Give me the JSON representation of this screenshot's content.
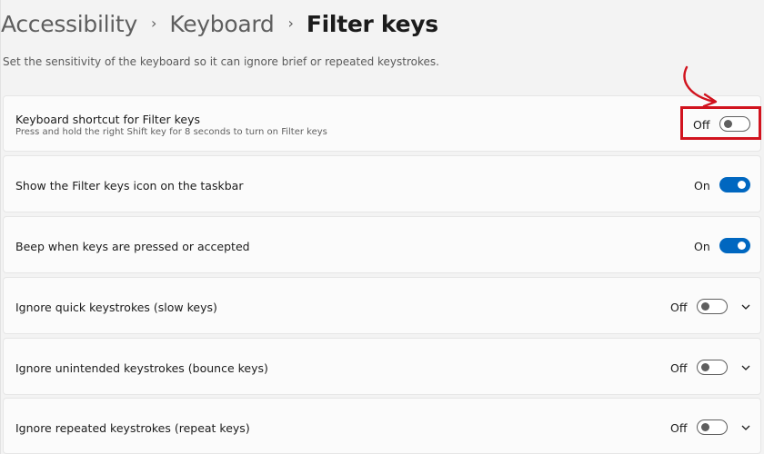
{
  "breadcrumb": {
    "items": [
      "Accessibility",
      "Keyboard",
      "Filter keys"
    ]
  },
  "description": "Set the sensitivity of the keyboard so it can ignore brief or repeated keystrokes.",
  "settings": [
    {
      "title": "Keyboard shortcut for Filter keys",
      "subtitle": "Press and hold the right Shift key for 8 seconds to turn on Filter keys",
      "state": "Off",
      "on": false,
      "expandable": false
    },
    {
      "title": "Show the Filter keys icon on the taskbar",
      "state": "On",
      "on": true,
      "expandable": false
    },
    {
      "title": "Beep when keys are pressed or accepted",
      "state": "On",
      "on": true,
      "expandable": false
    },
    {
      "title": "Ignore quick keystrokes (slow keys)",
      "state": "Off",
      "on": false,
      "expandable": true
    },
    {
      "title": "Ignore unintended keystrokes (bounce keys)",
      "state": "Off",
      "on": false,
      "expandable": true
    },
    {
      "title": "Ignore repeated keystrokes (repeat keys)",
      "state": "Off",
      "on": false,
      "expandable": true
    }
  ],
  "colors": {
    "accent": "#0067c0",
    "highlight": "#d1131e"
  },
  "icons": {
    "breadcrumb_separator": "chevron-right-icon",
    "expand": "chevron-down-icon",
    "annotation": "curved-arrow-icon"
  }
}
